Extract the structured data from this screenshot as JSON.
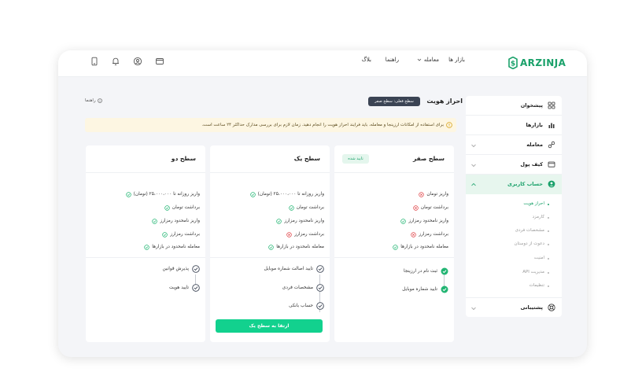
{
  "brand": {
    "name": "ARZINJA",
    "color": "#1aa16a"
  },
  "colors": {
    "accent": "#12d18e",
    "success": "#22b573",
    "danger": "#e0464a",
    "warning_bg": "#fdf6e2",
    "dark": "#3b4454"
  },
  "topnav": {
    "markets": "بازار ها",
    "trade": "معامله",
    "guide": "راهنما",
    "blog": "بلاگ"
  },
  "top_icons": [
    "wallet-icon",
    "user-circle-icon",
    "bell-icon",
    "mobile-download-icon"
  ],
  "sidebar": {
    "items": [
      {
        "label": "پیشخوان",
        "icon": "grid-icon"
      },
      {
        "label": "بازارها",
        "icon": "chart-icon"
      },
      {
        "label": "معامله",
        "icon": "exchange-icon"
      },
      {
        "label": "کیف پول",
        "icon": "wallet-icon"
      },
      {
        "label": "حساب کاربری",
        "icon": "user-icon"
      },
      {
        "label": "پشتیبانی",
        "icon": "support-icon"
      }
    ],
    "subitems": [
      "احراز هویت",
      "کارمزد",
      "مشخصات فردی",
      "دعوت از دوستان",
      "امنیت",
      "مدیریت API",
      "تنظیمات"
    ]
  },
  "header": {
    "title": "احراز هویت",
    "current_level": "سطح فعلی: سطح صفر",
    "guide": "راهنما"
  },
  "notice": "برای استفاده از امکانات ارزینجا و معامله، باید فرایند احراز هویت را انجام دهید. زمان لازم برای بررسی مدارک حداکثر ۲۴ ساعت است.",
  "levels": [
    {
      "title": "سطح صفر",
      "badge": "تایید شده",
      "features": [
        {
          "text": "واریز تومان",
          "ok": false
        },
        {
          "text": "برداشت تومان",
          "ok": false
        },
        {
          "text": "واریز نامحدود رمزارز",
          "ok": true
        },
        {
          "text": "برداشت رمزارز",
          "ok": false
        },
        {
          "text": "معامله نامحدود در بازارها",
          "ok": true
        }
      ],
      "steps": [
        "ثبت نام در ارزینجا",
        "تایید شماره موبایل"
      ]
    },
    {
      "title": "سطح یک",
      "features": [
        {
          "text": "واریز روزانه تا ۲۵،۰۰۰،۰۰۰ (تومان)",
          "ok": true
        },
        {
          "text": "برداشت تومان",
          "ok": true
        },
        {
          "text": "واریز نامحدود رمزارز",
          "ok": true
        },
        {
          "text": "برداشت رمزارز",
          "ok": false
        },
        {
          "text": "معامله نامحدود در بازارها",
          "ok": true
        }
      ],
      "steps": [
        "تایید اصالت شماره موبایل",
        "مشخصات فردی",
        "حساب بانکی"
      ],
      "button": "ارتقا به سطح یک"
    },
    {
      "title": "سطح دو",
      "features": [
        {
          "text": "واریز روزانه تا ۲۵،۰۰۰،۰۰۰ (تومان)",
          "ok": true
        },
        {
          "text": "برداشت تومان",
          "ok": true
        },
        {
          "text": "واریز نامحدود رمزارز",
          "ok": true
        },
        {
          "text": "برداشت رمزارز",
          "ok": true
        },
        {
          "text": "معامله نامحدود در بازارها",
          "ok": true
        }
      ],
      "steps": [
        "پذیرش قوانین",
        "تایید هویت"
      ]
    }
  ]
}
